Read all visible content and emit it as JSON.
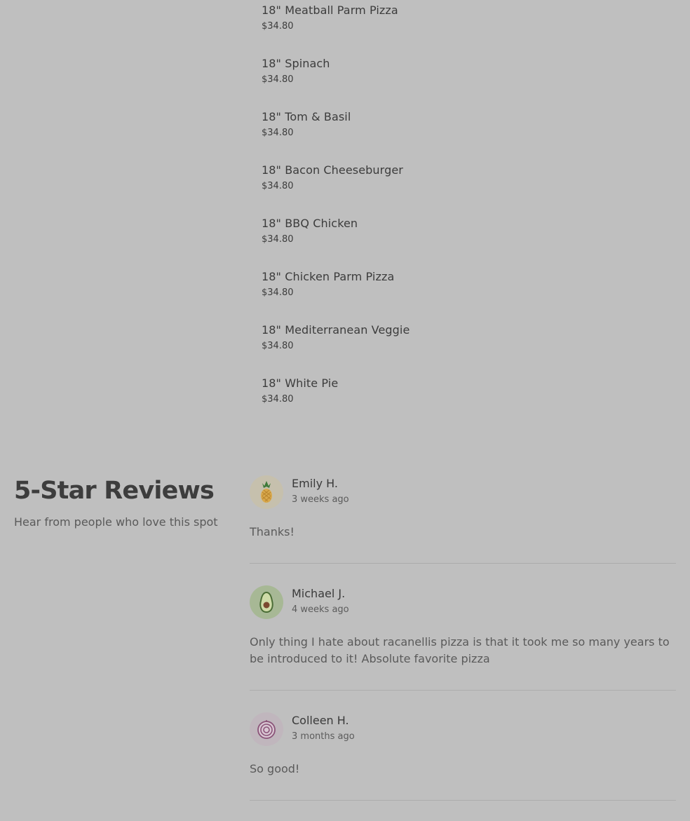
{
  "menu": {
    "items": [
      {
        "name": "18\" Meatball Parm Pizza",
        "price": "$34.80"
      },
      {
        "name": "18\" Spinach",
        "price": "$34.80"
      },
      {
        "name": "18\" Tom & Basil",
        "price": "$34.80"
      },
      {
        "name": "18\" Bacon Cheeseburger",
        "price": "$34.80"
      },
      {
        "name": "18\" BBQ Chicken",
        "price": "$34.80"
      },
      {
        "name": "18\" Chicken Parm Pizza",
        "price": "$34.80"
      },
      {
        "name": "18\" Mediterranean Veggie",
        "price": "$34.80"
      },
      {
        "name": "18\" White Pie",
        "price": "$34.80"
      }
    ]
  },
  "reviews": {
    "title": "5-Star Reviews",
    "subtitle": "Hear from people who love this spot",
    "items": [
      {
        "author": "Emily H.",
        "when": "3 weeks ago",
        "text": "Thanks!",
        "avatar_icon": "pineapple-icon",
        "avatar_bg": "#c6c0ad"
      },
      {
        "author": "Michael J.",
        "when": "4 weeks ago",
        "text": "Only thing I hate about racanellis pizza is that it took me so many years to be introduced to it! Absolute favorite pizza",
        "avatar_icon": "avocado-icon",
        "avatar_bg": "#a7b895"
      },
      {
        "author": "Colleen H.",
        "when": "3 months ago",
        "text": "So good!",
        "avatar_icon": "onion-icon",
        "avatar_bg": "#c0b6bd"
      }
    ]
  }
}
